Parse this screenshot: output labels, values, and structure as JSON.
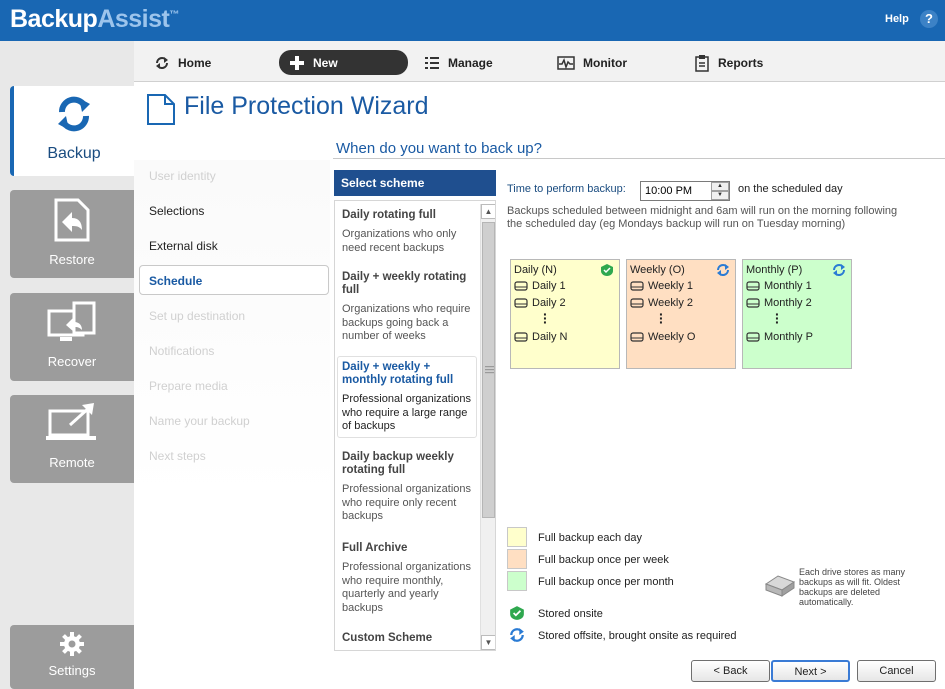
{
  "app": {
    "logo_part1": "Backup",
    "logo_part2": "Assist",
    "logo_tm": "™",
    "help_label": "Help",
    "help_icon_text": "?"
  },
  "toolbar": {
    "home": "Home",
    "new": "New",
    "manage": "Manage",
    "monitor": "Monitor",
    "reports": "Reports"
  },
  "leftnav": {
    "backup": "Backup",
    "restore": "Restore",
    "recover": "Recover",
    "remote": "Remote",
    "settings": "Settings"
  },
  "wizard": {
    "title": "File Protection Wizard",
    "heading": "When do you want to back up?"
  },
  "steps": [
    {
      "label": "User identity",
      "state": "pending"
    },
    {
      "label": "Selections",
      "state": "done"
    },
    {
      "label": "External disk",
      "state": "done"
    },
    {
      "label": "Schedule",
      "state": "current"
    },
    {
      "label": "Set up destination",
      "state": "pending"
    },
    {
      "label": "Notifications",
      "state": "pending"
    },
    {
      "label": "Prepare media",
      "state": "pending"
    },
    {
      "label": "Name your backup",
      "state": "pending"
    },
    {
      "label": "Next steps",
      "state": "pending"
    }
  ],
  "schemes": {
    "header": "Select scheme",
    "items": [
      {
        "name": "Daily rotating full",
        "desc": "Organizations who only need recent backups"
      },
      {
        "name": "Daily + weekly rotating full",
        "desc": "Organizations who require backups going back a number of weeks"
      },
      {
        "name": "Daily + weekly + monthly rotating full",
        "desc": "Professional organizations who require a large range of backups",
        "selected": true
      },
      {
        "name": "Daily backup weekly rotating full",
        "desc": "Professional organizations who require only recent backups"
      },
      {
        "name": "Full Archive",
        "desc": "Professional organizations who require monthly, quarterly and yearly backups"
      },
      {
        "name": "Custom Scheme",
        "desc": ""
      }
    ]
  },
  "schedule": {
    "time_label": "Time to perform backup:",
    "time_value": "10:00 PM",
    "time_suffix": "on the scheduled day",
    "note": "Backups scheduled between midnight and 6am will run on the morning following the scheduled day (eg Mondays backup will run on Tuesday morning)"
  },
  "rotation": {
    "daily": {
      "title": "Daily (N)",
      "items": [
        "Daily 1",
        "Daily 2",
        "Daily N"
      ],
      "color": "#ffffcc"
    },
    "weekly": {
      "title": "Weekly (O)",
      "items": [
        "Weekly 1",
        "Weekly 2",
        "Weekly O"
      ],
      "color": "#ffdfc2"
    },
    "monthly": {
      "title": "Monthly (P)",
      "items": [
        "Monthly 1",
        "Monthly 2",
        "Monthly P"
      ],
      "color": "#ccffcc"
    }
  },
  "legend": {
    "daily": "Full backup each day",
    "weekly": "Full backup once per week",
    "monthly": "Full backup once per month",
    "onsite": "Stored onsite",
    "offsite": "Stored offsite, brought onsite as required",
    "drive_note": "Each drive stores as many backups as will fit. Oldest backups are deleted automatically."
  },
  "buttons": {
    "back": "< Back",
    "next": "Next >",
    "cancel": "Cancel"
  },
  "colors": {
    "brand_blue": "#1967b3",
    "scheme_header": "#1f4f8f"
  }
}
